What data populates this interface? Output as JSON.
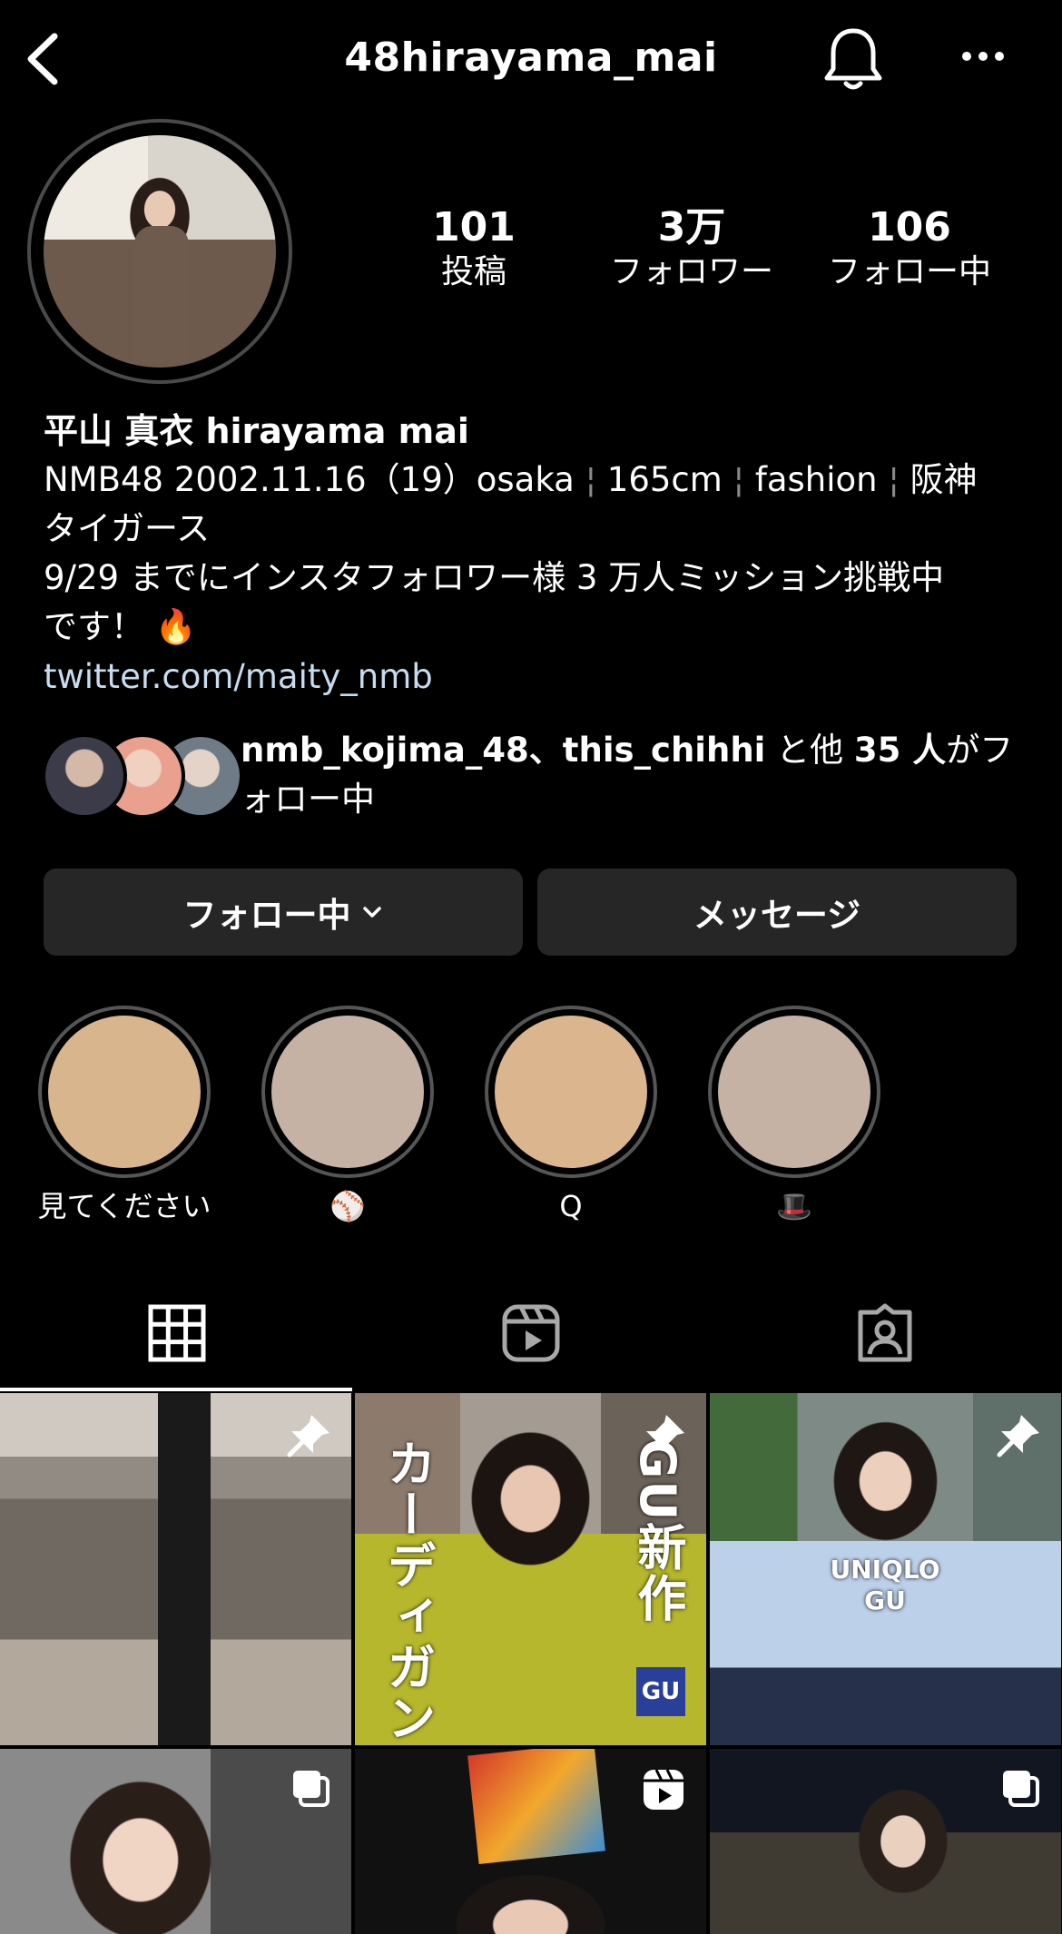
{
  "header": {
    "username": "48hirayama_mai"
  },
  "stats": [
    {
      "count": "101",
      "label": "投稿"
    },
    {
      "count": "3万",
      "label": "フォロワー"
    },
    {
      "count": "106",
      "label": "フォロー中"
    }
  ],
  "bio": {
    "name": "平山 真衣  hirayama mai",
    "line1_a": "NMB48 2002.11.16（19）osaka",
    "line1_b": "165cm",
    "line1_c": "fashion",
    "line1_d": "阪神",
    "line1_cont": "タイガース",
    "line2": "9/29 までにインスタフォロワー様 3 万人ミッション挑戦中",
    "line2_cont": "です！ 🔥",
    "link": "twitter.com/maity_nmb"
  },
  "followed_by": {
    "users": "nmb_kojima_48、this_chihhi",
    "middle": " と他 ",
    "count": "35 人",
    "suffix": "がフォロー中"
  },
  "actions": {
    "follow_label": "フォロー中",
    "message_label": "メッセージ"
  },
  "highlights": [
    {
      "label": "見てください",
      "color": "#d9b58e"
    },
    {
      "label": "⚾",
      "color": "#c5b2a4"
    },
    {
      "label": "Q",
      "color": "#dbb58e"
    },
    {
      "label": "🎩",
      "color": "#c6b2a5"
    }
  ],
  "tabs": [
    "grid-icon",
    "reels-icon",
    "tagged-icon"
  ],
  "posts": {
    "p2_text_left": "カーディガン",
    "p2_text_right": "GU新作",
    "p2_badge": "GU",
    "p3_text": "UNIQLO\nGU"
  }
}
